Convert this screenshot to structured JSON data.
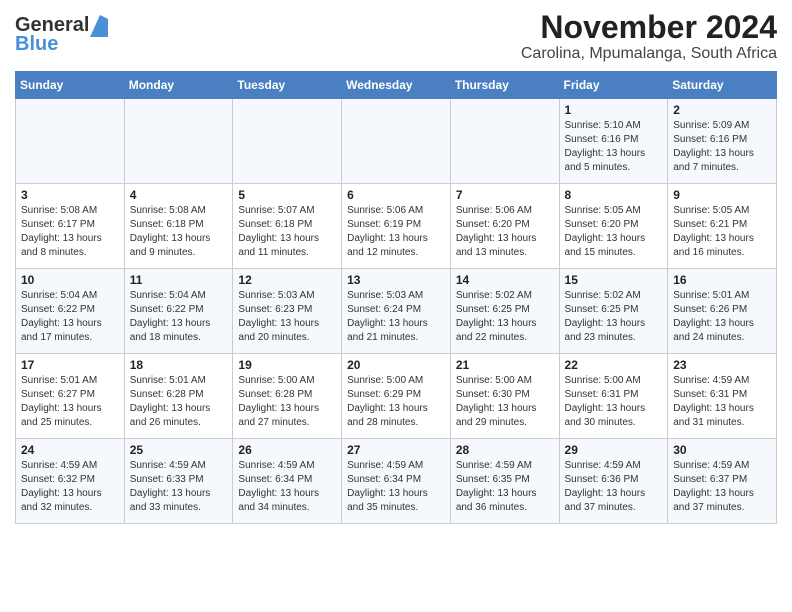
{
  "header": {
    "logo_general": "General",
    "logo_blue": "Blue",
    "title": "November 2024",
    "subtitle": "Carolina, Mpumalanga, South Africa"
  },
  "calendar": {
    "days_of_week": [
      "Sunday",
      "Monday",
      "Tuesday",
      "Wednesday",
      "Thursday",
      "Friday",
      "Saturday"
    ],
    "weeks": [
      [
        {
          "day": "",
          "info": ""
        },
        {
          "day": "",
          "info": ""
        },
        {
          "day": "",
          "info": ""
        },
        {
          "day": "",
          "info": ""
        },
        {
          "day": "",
          "info": ""
        },
        {
          "day": "1",
          "info": "Sunrise: 5:10 AM\nSunset: 6:16 PM\nDaylight: 13 hours and 5 minutes."
        },
        {
          "day": "2",
          "info": "Sunrise: 5:09 AM\nSunset: 6:16 PM\nDaylight: 13 hours and 7 minutes."
        }
      ],
      [
        {
          "day": "3",
          "info": "Sunrise: 5:08 AM\nSunset: 6:17 PM\nDaylight: 13 hours and 8 minutes."
        },
        {
          "day": "4",
          "info": "Sunrise: 5:08 AM\nSunset: 6:18 PM\nDaylight: 13 hours and 9 minutes."
        },
        {
          "day": "5",
          "info": "Sunrise: 5:07 AM\nSunset: 6:18 PM\nDaylight: 13 hours and 11 minutes."
        },
        {
          "day": "6",
          "info": "Sunrise: 5:06 AM\nSunset: 6:19 PM\nDaylight: 13 hours and 12 minutes."
        },
        {
          "day": "7",
          "info": "Sunrise: 5:06 AM\nSunset: 6:20 PM\nDaylight: 13 hours and 13 minutes."
        },
        {
          "day": "8",
          "info": "Sunrise: 5:05 AM\nSunset: 6:20 PM\nDaylight: 13 hours and 15 minutes."
        },
        {
          "day": "9",
          "info": "Sunrise: 5:05 AM\nSunset: 6:21 PM\nDaylight: 13 hours and 16 minutes."
        }
      ],
      [
        {
          "day": "10",
          "info": "Sunrise: 5:04 AM\nSunset: 6:22 PM\nDaylight: 13 hours and 17 minutes."
        },
        {
          "day": "11",
          "info": "Sunrise: 5:04 AM\nSunset: 6:22 PM\nDaylight: 13 hours and 18 minutes."
        },
        {
          "day": "12",
          "info": "Sunrise: 5:03 AM\nSunset: 6:23 PM\nDaylight: 13 hours and 20 minutes."
        },
        {
          "day": "13",
          "info": "Sunrise: 5:03 AM\nSunset: 6:24 PM\nDaylight: 13 hours and 21 minutes."
        },
        {
          "day": "14",
          "info": "Sunrise: 5:02 AM\nSunset: 6:25 PM\nDaylight: 13 hours and 22 minutes."
        },
        {
          "day": "15",
          "info": "Sunrise: 5:02 AM\nSunset: 6:25 PM\nDaylight: 13 hours and 23 minutes."
        },
        {
          "day": "16",
          "info": "Sunrise: 5:01 AM\nSunset: 6:26 PM\nDaylight: 13 hours and 24 minutes."
        }
      ],
      [
        {
          "day": "17",
          "info": "Sunrise: 5:01 AM\nSunset: 6:27 PM\nDaylight: 13 hours and 25 minutes."
        },
        {
          "day": "18",
          "info": "Sunrise: 5:01 AM\nSunset: 6:28 PM\nDaylight: 13 hours and 26 minutes."
        },
        {
          "day": "19",
          "info": "Sunrise: 5:00 AM\nSunset: 6:28 PM\nDaylight: 13 hours and 27 minutes."
        },
        {
          "day": "20",
          "info": "Sunrise: 5:00 AM\nSunset: 6:29 PM\nDaylight: 13 hours and 28 minutes."
        },
        {
          "day": "21",
          "info": "Sunrise: 5:00 AM\nSunset: 6:30 PM\nDaylight: 13 hours and 29 minutes."
        },
        {
          "day": "22",
          "info": "Sunrise: 5:00 AM\nSunset: 6:31 PM\nDaylight: 13 hours and 30 minutes."
        },
        {
          "day": "23",
          "info": "Sunrise: 4:59 AM\nSunset: 6:31 PM\nDaylight: 13 hours and 31 minutes."
        }
      ],
      [
        {
          "day": "24",
          "info": "Sunrise: 4:59 AM\nSunset: 6:32 PM\nDaylight: 13 hours and 32 minutes."
        },
        {
          "day": "25",
          "info": "Sunrise: 4:59 AM\nSunset: 6:33 PM\nDaylight: 13 hours and 33 minutes."
        },
        {
          "day": "26",
          "info": "Sunrise: 4:59 AM\nSunset: 6:34 PM\nDaylight: 13 hours and 34 minutes."
        },
        {
          "day": "27",
          "info": "Sunrise: 4:59 AM\nSunset: 6:34 PM\nDaylight: 13 hours and 35 minutes."
        },
        {
          "day": "28",
          "info": "Sunrise: 4:59 AM\nSunset: 6:35 PM\nDaylight: 13 hours and 36 minutes."
        },
        {
          "day": "29",
          "info": "Sunrise: 4:59 AM\nSunset: 6:36 PM\nDaylight: 13 hours and 37 minutes."
        },
        {
          "day": "30",
          "info": "Sunrise: 4:59 AM\nSunset: 6:37 PM\nDaylight: 13 hours and 37 minutes."
        }
      ]
    ]
  }
}
